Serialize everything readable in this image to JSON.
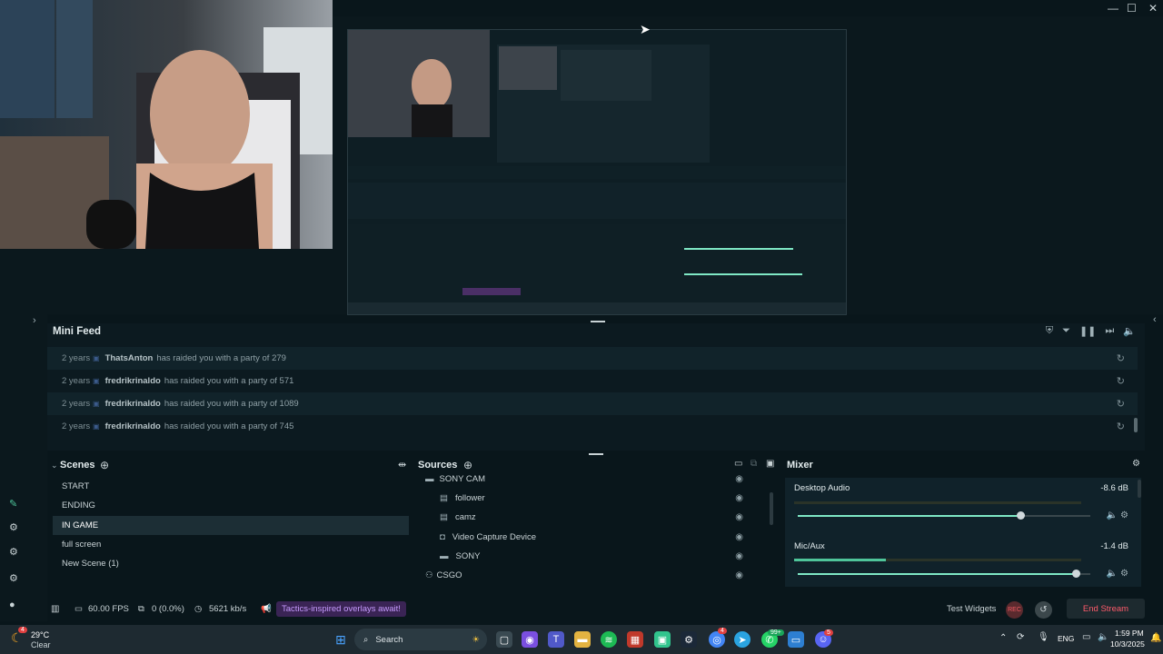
{
  "window": {
    "minimize": "—",
    "maximize": "☐",
    "close": "✕"
  },
  "mini_feed": {
    "title": "Mini Feed",
    "rows": [
      {
        "age": "2 years",
        "user": "ThatsAnton",
        "message": "has raided you with a party of 279"
      },
      {
        "age": "2 years",
        "user": "fredrikrinaldo",
        "message": "has raided you with a party of 571"
      },
      {
        "age": "2 years",
        "user": "fredrikrinaldo",
        "message": "has raided you with a party of 1089"
      },
      {
        "age": "2 years",
        "user": "fredrikrinaldo",
        "message": "has raided you with a party of 745"
      }
    ]
  },
  "scenes": {
    "title": "Scenes",
    "items": [
      "START",
      "ENDING",
      "IN GAME",
      "full screen",
      "New Scene (1)"
    ],
    "active": "IN GAME"
  },
  "sources": {
    "title": "Sources",
    "items": [
      {
        "label": "SONY CAM",
        "icon": "folder-icon"
      },
      {
        "label": "follower",
        "icon": "browser-icon"
      },
      {
        "label": "camz",
        "icon": "browser-icon"
      },
      {
        "label": "Video Capture Device",
        "icon": "camera-icon"
      },
      {
        "label": "SONY",
        "icon": "display-icon"
      },
      {
        "label": "CSGO",
        "icon": "gamepad-icon"
      }
    ]
  },
  "mixer": {
    "title": "Mixer",
    "channels": [
      {
        "name": "Desktop Audio",
        "db": "-8.6 dB",
        "level": 0.0,
        "volume": 0.76
      },
      {
        "name": "Mic/Aux",
        "db": "-1.4 dB",
        "level": 0.32,
        "volume": 0.95
      }
    ]
  },
  "status": {
    "fps": "60.00 FPS",
    "dropped": "0 (0.0%)",
    "bitrate": "5621 kb/s",
    "promo": "Tactics-inspired overlays await!",
    "test_widgets": "Test Widgets",
    "rec": "REC",
    "end_stream": "End Stream"
  },
  "taskbar": {
    "weather_temp": "29°C",
    "weather_cond": "Clear",
    "weather_badge": "4",
    "search": "Search",
    "lang": "ENG",
    "time": "1:59 PM",
    "date": "10/3/2025",
    "whatsapp_badge": "99+",
    "discord_badge": "5",
    "chrome_badge": "4"
  },
  "colors": {
    "accent": "#4fc59a",
    "end_stream": "#ff5b6b",
    "promo": "#c79bff"
  }
}
